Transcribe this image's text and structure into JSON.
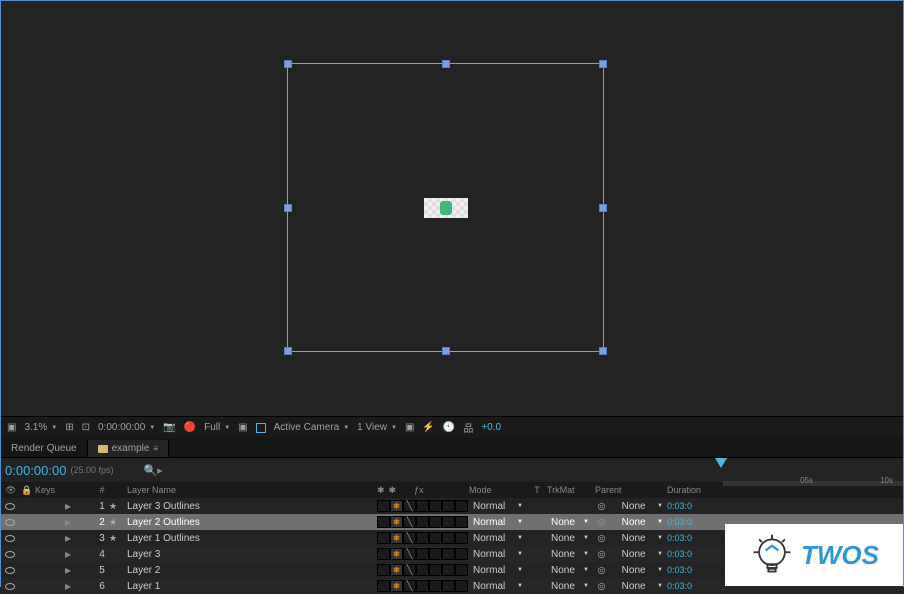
{
  "colors": {
    "accent": "#3db7e6",
    "selection": "#707070",
    "brand_blue": "#3097d4"
  },
  "viewport": {
    "selected": true
  },
  "toolbar": {
    "zoom": "3.1%",
    "timecode": "0:00:00:00",
    "resolution": "Full",
    "camera": "Active Camera",
    "view_count": "1 View",
    "exposure": "+0.0"
  },
  "tabs": [
    {
      "label": "Render Queue",
      "active": false
    },
    {
      "label": "example",
      "active": true,
      "has_icon": true,
      "has_menu": true
    }
  ],
  "timecode_row": {
    "time": "0:00:00:00",
    "fps": "(25.00 fps)",
    "ruler": [
      "05s",
      "10s"
    ]
  },
  "column_headers": {
    "lock": "🔒",
    "keys": "Keys",
    "num": "#",
    "layer_name": "Layer Name",
    "mode": "Mode",
    "t": "T",
    "trkmat": "TrkMat",
    "parent": "Parent",
    "duration": "Duration"
  },
  "layers": [
    {
      "num": "1",
      "name": "Layer 3 Outlines",
      "type": "shape",
      "mode": "Normal",
      "trkmat": "",
      "parent": "None",
      "duration": "0:03:0",
      "selected": false,
      "color": "c1"
    },
    {
      "num": "2",
      "name": "Layer 2 Outlines",
      "type": "shape",
      "mode": "Normal",
      "trkmat": "None",
      "parent": "None",
      "duration": "0:03:0",
      "selected": true,
      "color": "c1"
    },
    {
      "num": "3",
      "name": "Layer 1 Outlines",
      "type": "shape",
      "mode": "Normal",
      "trkmat": "None",
      "parent": "None",
      "duration": "0:03:0",
      "selected": false,
      "color": "c1"
    },
    {
      "num": "4",
      "name": "Layer 3",
      "type": "footage",
      "mode": "Normal",
      "trkmat": "None",
      "parent": "None",
      "duration": "0:03:0",
      "selected": false,
      "color": "c2"
    },
    {
      "num": "5",
      "name": "Layer 2",
      "type": "footage",
      "mode": "Normal",
      "trkmat": "None",
      "parent": "None",
      "duration": "0:03:0",
      "selected": false,
      "color": "c2"
    },
    {
      "num": "6",
      "name": "Layer 1",
      "type": "footage",
      "mode": "Normal",
      "trkmat": "None",
      "parent": "None",
      "duration": "0:03:0",
      "selected": false,
      "color": "c2"
    }
  ],
  "overlay": {
    "text": "TWOS"
  }
}
